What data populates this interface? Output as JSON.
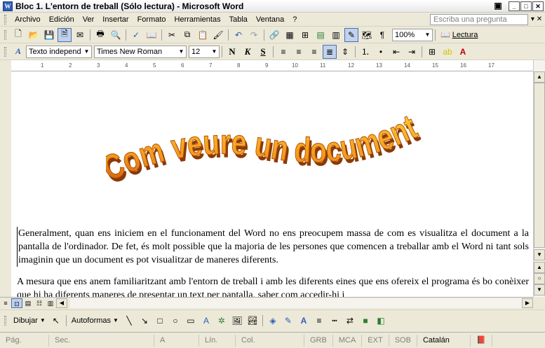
{
  "window": {
    "title": "Bloc 1. L'entorn de treball (Sólo lectura) - Microsoft Word",
    "app_icon": "word-icon"
  },
  "menu": {
    "items": [
      "Archivo",
      "Edición",
      "Ver",
      "Insertar",
      "Formato",
      "Herramientas",
      "Tabla",
      "Ventana",
      "?"
    ],
    "help_placeholder": "Escriba una pregunta"
  },
  "standard_toolbar": {
    "zoom": "100%",
    "reading_label": "Lectura"
  },
  "formatting_toolbar": {
    "style": "Texto independ",
    "font": "Times New Roman",
    "size": "12",
    "bold": "N",
    "italic": "K",
    "underline": "S"
  },
  "ruler": {
    "numbers": [
      "1",
      "2",
      "3",
      "4",
      "5",
      "6",
      "7",
      "8",
      "9",
      "10",
      "11",
      "12",
      "13",
      "14",
      "15",
      "16",
      "17"
    ]
  },
  "document": {
    "wordart": "Com veure un document",
    "paragraphs": [
      "Generalment, quan ens iniciem en el funcionament del Word no ens preocupem massa de com es visualitza el document a la pantalla de l'ordinador. De fet, és molt possible que la majoria de les persones que comencen a treballar amb el Word ni tant sols imaginin que un document es pot visualitzar de maneres diferents.",
      "A mesura que ens anem familiaritzant amb l'entorn de treball i amb les diferents eines que ens ofereix el programa és bo conèixer que hi ha diferents maneres de presentar un text per pantalla, saber com accedir-hi i"
    ]
  },
  "drawing_toolbar": {
    "draw_label": "Dibujar",
    "autoshapes_label": "Autoformas"
  },
  "status": {
    "page": "Pág.",
    "section": "Sec.",
    "at": "A",
    "line": "Lín.",
    "col": "Col.",
    "grb": "GRB",
    "mca": "MCA",
    "ext": "EXT",
    "sob": "SOB",
    "language": "Catalán"
  }
}
